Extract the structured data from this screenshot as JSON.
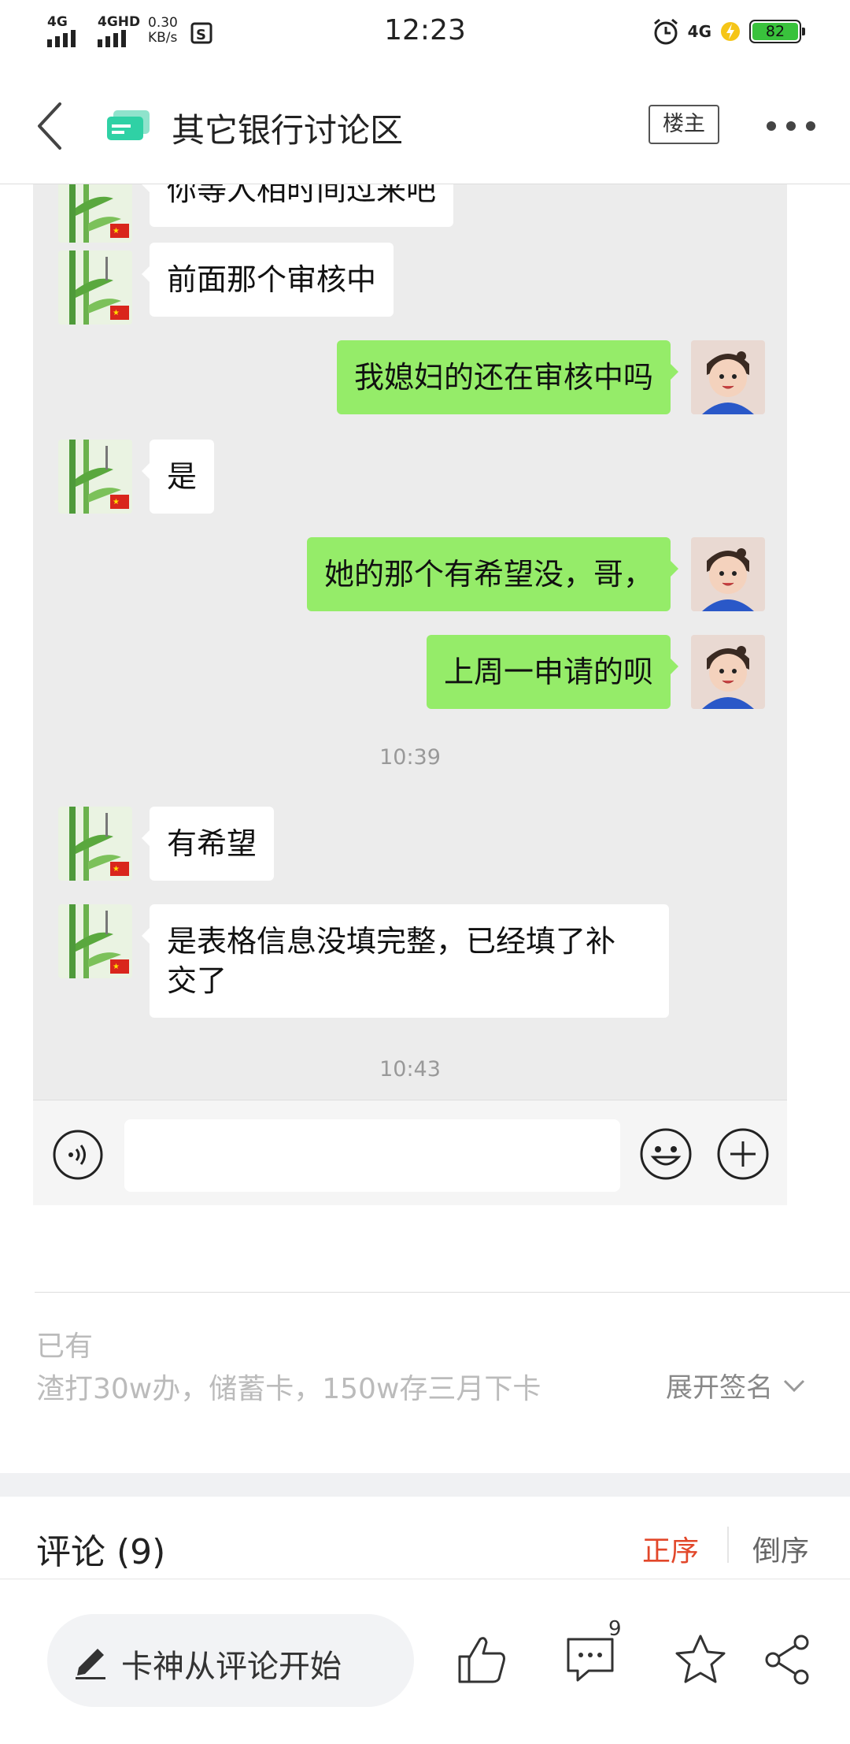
{
  "status_bar": {
    "signal1_label": "4G",
    "signal2_label": "4GHD",
    "net_speed_value": "0.30",
    "net_speed_unit": "KB/s",
    "time": "12:23",
    "network_right": "4G",
    "battery_level": "82"
  },
  "nav": {
    "title": "其它银行讨论区",
    "op_button": "楼主"
  },
  "chat": {
    "messages": [
      {
        "side": "in",
        "text": "你等人相时间过来吧"
      },
      {
        "side": "in",
        "text": "前面那个审核中"
      },
      {
        "side": "out",
        "text": "我媳妇的还在审核中吗"
      },
      {
        "side": "in",
        "text": "是"
      },
      {
        "side": "out",
        "text": "她的那个有希望没，哥，"
      },
      {
        "side": "out",
        "text": "上周一申请的呗"
      },
      {
        "side": "in",
        "text": "有希望"
      },
      {
        "side": "in",
        "text_line1": "是表格信息没填完整，已经填了补",
        "text_line2": "交了"
      }
    ],
    "timestamps": [
      "10:39",
      "10:43"
    ]
  },
  "signature": {
    "label": "已有",
    "text": "渣打30w办，储蓄卡，150w存三月下卡",
    "expand_label": "展开签名"
  },
  "comments": {
    "title": "评论",
    "count": "(9)",
    "sort_asc": "正序",
    "sort_desc": "倒序"
  },
  "bottom_bar": {
    "comment_placeholder": "卡神从评论开始",
    "comment_badge": "9"
  },
  "colors": {
    "accent_red": "#e2472a",
    "bubble_green": "#95ec69",
    "forum_icon_green": "#2fd1a5",
    "battery_green": "#39c23c"
  },
  "icons": [
    "back-icon",
    "forum-icon",
    "more-icon",
    "voice-icon",
    "emoji-icon",
    "plus-icon",
    "chevron-down-icon",
    "pencil-icon",
    "thumbs-up-icon",
    "comment-icon",
    "star-icon",
    "share-icon"
  ]
}
